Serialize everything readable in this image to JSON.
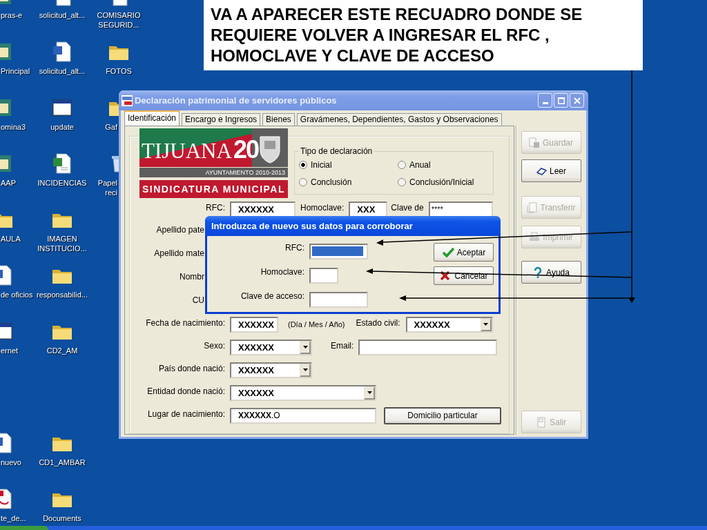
{
  "desktop": {
    "icon_columns": [
      [
        {
          "label": "pras-e",
          "kind": "app"
        },
        {
          "label": "Principal",
          "kind": "app"
        },
        {
          "label": "omina3",
          "kind": "app"
        },
        {
          "label": "AAP",
          "kind": "app"
        },
        {
          "label": "AULA",
          "kind": "folder"
        },
        {
          "label": "de oficios",
          "kind": "word"
        },
        {
          "label": "ernet",
          "kind": "window"
        },
        {
          "label": "nuevo",
          "kind": "word"
        },
        {
          "label": "te_de...",
          "kind": "pdf"
        }
      ],
      [
        {
          "label": "solicitud_alt...",
          "kind": "word"
        },
        {
          "label": "solicitud_alt...",
          "kind": "word"
        },
        {
          "label": "update",
          "kind": "window"
        },
        {
          "label": "INCIDENCIAS",
          "kind": "excel"
        },
        {
          "label": "IMAGEN INSTITUCIO...",
          "kind": "folder"
        },
        {
          "label": "responsabilid...",
          "kind": "folder"
        },
        {
          "label": "CD2_AM",
          "kind": "folder"
        },
        {
          "label": "CD1_AMBAR",
          "kind": "folder"
        },
        {
          "label": "Documents",
          "kind": "folder"
        }
      ],
      [
        {
          "label": "COMISARIO SEGURID...",
          "kind": "word"
        },
        {
          "label": "FOTOS",
          "kind": "folder"
        },
        {
          "label": "Gaf",
          "kind": "folder"
        },
        {
          "label": "Papel reci",
          "kind": "recycle"
        }
      ]
    ]
  },
  "note": {
    "text": "VA A APARECER ESTE RECUADRO DONDE SE REQUIERE VOLVER A INGRESAR EL RFC , HOMOCLAVE Y CLAVE DE ACCESO"
  },
  "window": {
    "title": "Declaración patrimonial de servidores públicos",
    "tabs": [
      {
        "label": "Identificación",
        "selected": true
      },
      {
        "label": "Encargo e Ingresos",
        "selected": false
      },
      {
        "label": "Bienes",
        "selected": false
      },
      {
        "label": "Gravámenes, Dependientes, Gastos y Observaciones",
        "selected": false
      }
    ],
    "logo": {
      "name": "TIJUANA",
      "number": "20",
      "banner": "AYUNTAMIENTO 2010-2013",
      "department": "SINDICATURA MUNICIPAL"
    },
    "declaration_type": {
      "title": "Tipo de declaración",
      "options": [
        {
          "label": "Inicial",
          "selected": true
        },
        {
          "label": "Anual",
          "selected": false
        },
        {
          "label": "Conclusión",
          "selected": false
        },
        {
          "label": "Conclusión/Inicial",
          "selected": false
        }
      ]
    },
    "rfc": {
      "label": "RFC:",
      "value": "XXXXXX"
    },
    "homoclave": {
      "label": "Homoclave:",
      "value": "XXX"
    },
    "access_key": {
      "label": "Clave de",
      "value": "****"
    },
    "hidden_labels": [
      "Apellido pate",
      "Apellido mate",
      "Nombr",
      "CU"
    ],
    "birth_date": {
      "label": "Fecha de nacimiento:",
      "value": "XXXXXX",
      "hint": "(Día / Mes / Año)"
    },
    "marital_status": {
      "label": "Estado civil:",
      "value": "XXXXXX"
    },
    "sex": {
      "label": "Sexo:",
      "value": "XXXXXX"
    },
    "email": {
      "label": "Email:"
    },
    "birth_country": {
      "label": "País donde nació:",
      "value": "XXXXXX"
    },
    "birth_state": {
      "label": "Entidad donde nació:",
      "value": "XXXXXX"
    },
    "birth_place": {
      "label": "Lugar de nacimiento:",
      "value": "**XXXXXX**.O"
    },
    "address_button": "Domicilio particular",
    "actions": [
      {
        "label": "Guardar",
        "kind": "save",
        "disabled": true
      },
      {
        "label": "Leer",
        "kind": "read",
        "disabled": false
      },
      {
        "label": "Transferir",
        "kind": "transfer",
        "disabled": true
      },
      {
        "label": "Imprimir",
        "kind": "print",
        "disabled": true
      },
      {
        "label": "Ayuda",
        "kind": "help",
        "disabled": false
      },
      {
        "label": "Salir",
        "kind": "exit",
        "disabled": true
      }
    ]
  },
  "dialog": {
    "title": "Introduzca de nuevo sus datos para corroborar",
    "fields": [
      {
        "label": "RFC:",
        "selected": true
      },
      {
        "label": "Homoclave:",
        "selected": false
      },
      {
        "label": "Clave de acceso:",
        "selected": false
      }
    ],
    "buttons": [
      {
        "label": "Aceptar",
        "kind": "ok"
      },
      {
        "label": "Cancelar",
        "kind": "cancel"
      }
    ]
  }
}
